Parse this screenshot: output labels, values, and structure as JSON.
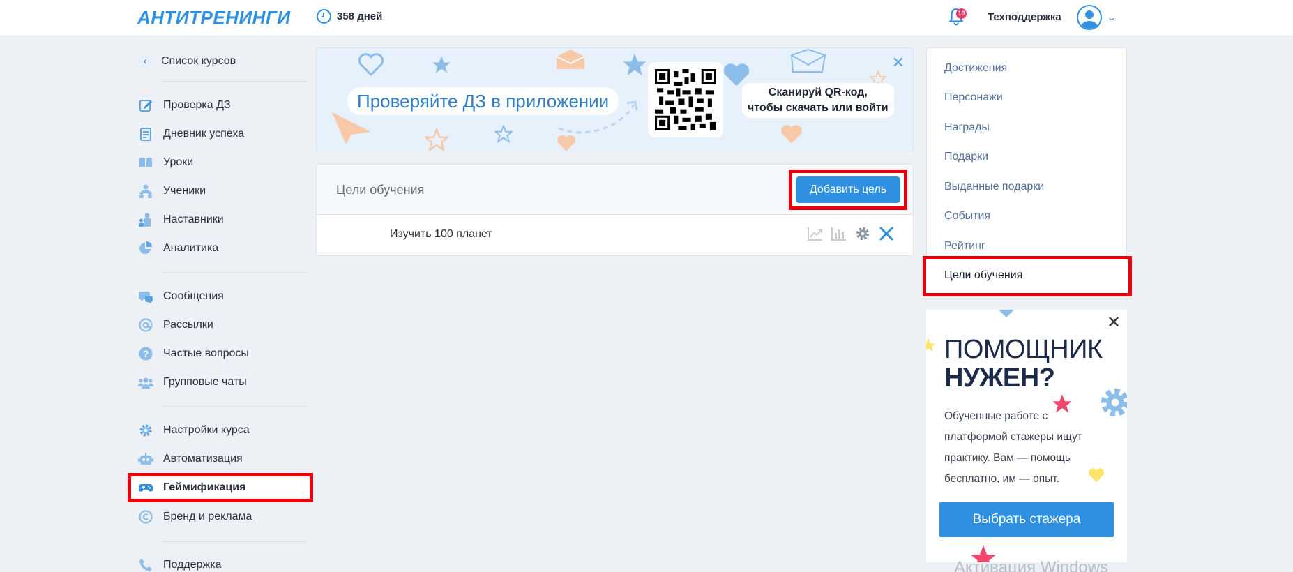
{
  "header": {
    "logo": "АНТИТРЕНИНГИ",
    "days": "358 дней",
    "notifications_count": "10",
    "user_name": "Техподдержка"
  },
  "sidebar": {
    "back_label": "Список курсов",
    "groups": [
      [
        {
          "label": "Проверка ДЗ",
          "icon": "edit-icon"
        },
        {
          "label": "Дневник успеха",
          "icon": "journal-icon"
        },
        {
          "label": "Уроки",
          "icon": "book-icon"
        },
        {
          "label": "Ученики",
          "icon": "students-icon"
        },
        {
          "label": "Наставники",
          "icon": "mentors-icon"
        },
        {
          "label": "Аналитика",
          "icon": "pie-chart-icon"
        }
      ],
      [
        {
          "label": "Сообщения",
          "icon": "messages-icon"
        },
        {
          "label": "Рассылки",
          "icon": "at-icon"
        },
        {
          "label": "Частые вопросы",
          "icon": "question-icon"
        },
        {
          "label": "Групповые чаты",
          "icon": "group-chat-icon"
        }
      ],
      [
        {
          "label": "Настройки курса",
          "icon": "gear-icon"
        },
        {
          "label": "Автоматизация",
          "icon": "robot-icon"
        },
        {
          "label": "Геймификация",
          "icon": "gamepad-icon"
        },
        {
          "label": "Бренд и реклама",
          "icon": "copyright-icon"
        }
      ],
      [
        {
          "label": "Поддержка",
          "icon": "phone-icon"
        }
      ]
    ]
  },
  "banner": {
    "headline": "Проверяйте ДЗ в приложении",
    "scan_line1": "Сканируй QR-код,",
    "scan_line2": "чтобы скачать или войти"
  },
  "goals": {
    "title": "Цели обучения",
    "add_button": "Добавить цель",
    "rows": [
      {
        "name": "Изучить 100 планет"
      }
    ]
  },
  "right_menu": {
    "items": [
      "Достижения",
      "Персонажи",
      "Награды",
      "Подарки",
      "Выданные подарки",
      "События",
      "Рейтинг",
      "Цели обучения"
    ],
    "active_index": 7
  },
  "promo": {
    "title_line1": "ПОМОЩНИК",
    "title_line2": "НУЖЕН?",
    "text": "Обученные работе с платформой стажеры ищут практику. Вам — помощь бесплатно, им — опыт.",
    "button": "Выбрать стажера"
  },
  "watermark": "Активация Windows",
  "colors": {
    "accent": "#2f8fe0",
    "highlight": "#e8000d",
    "background": "#edf0f4",
    "badge": "#f0376a"
  }
}
